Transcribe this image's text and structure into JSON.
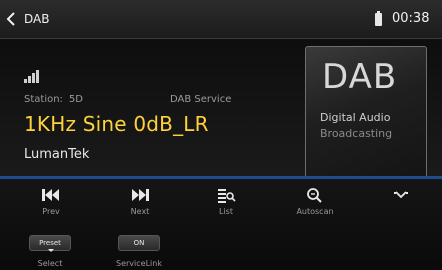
{
  "header": {
    "back_label": "DAB",
    "clock": "00:38"
  },
  "station": {
    "station_prefix": "Station:",
    "station_value": "5D",
    "service_label": "DAB Service",
    "title": "1KHz Sine 0dB_LR",
    "ensemble": "LumanTek"
  },
  "logo": {
    "main": "DAB",
    "line1": "Digital Audio",
    "line2": "Broadcasting"
  },
  "controls": {
    "prev": "Prev",
    "next": "Next",
    "list": "List",
    "autoscan": "Autoscan"
  },
  "toggles": {
    "preset_value": "Preset",
    "select_label": "Select",
    "servicelink_value": "ON",
    "servicelink_label": "ServiceLink"
  },
  "colors": {
    "accent": "#1e4c8c",
    "title": "#ffd23a"
  }
}
